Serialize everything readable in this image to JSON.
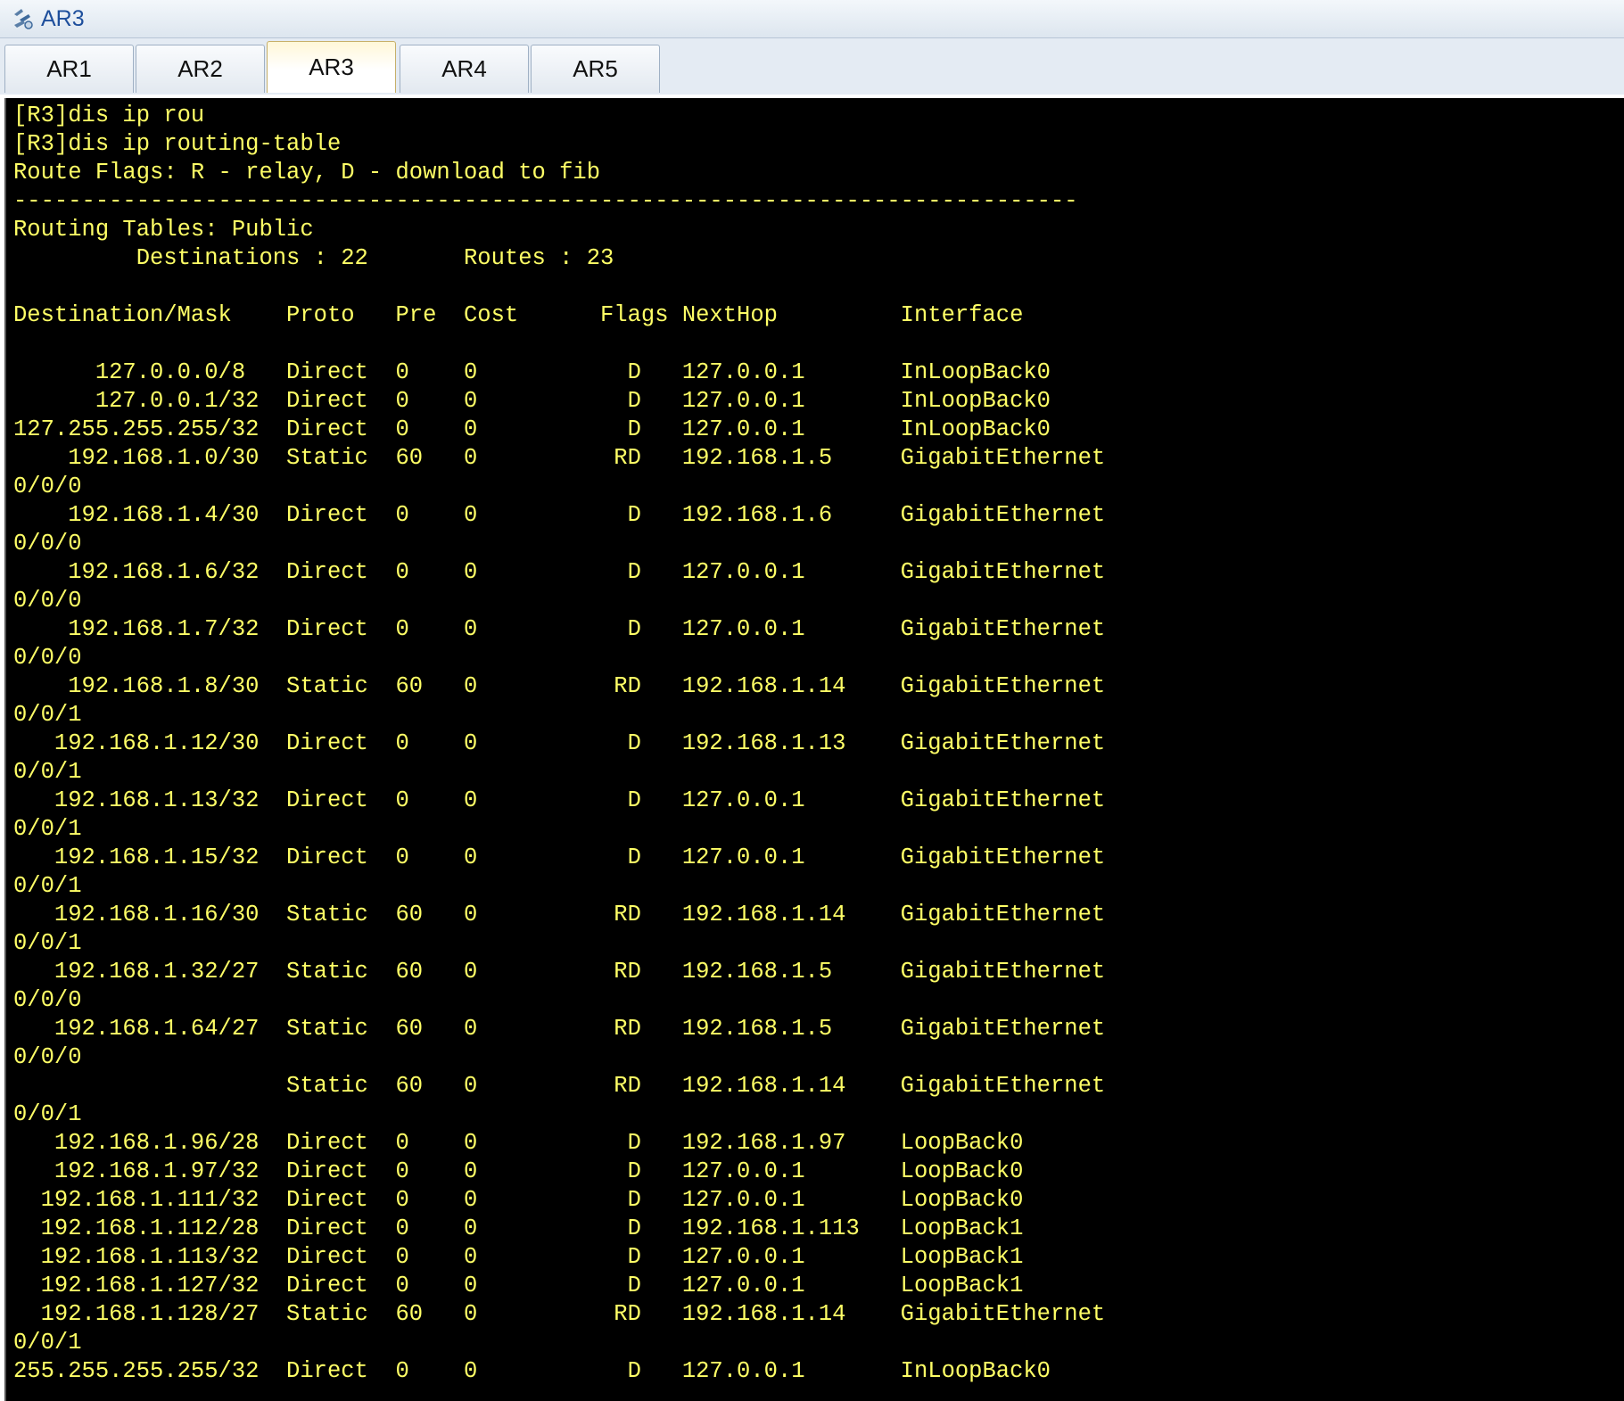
{
  "window": {
    "title": "AR3",
    "icon": "router-icon"
  },
  "tabs": [
    {
      "label": "AR1",
      "active": false
    },
    {
      "label": "AR2",
      "active": false
    },
    {
      "label": "AR3",
      "active": true
    },
    {
      "label": "AR4",
      "active": false
    },
    {
      "label": "AR5",
      "active": false
    }
  ],
  "colors": {
    "terminal_background": "#000000",
    "terminal_text": "#ffff66",
    "title_text": "#1e4f9c"
  },
  "terminal": {
    "lines": [
      "[R3]dis ip rou",
      "[R3]dis ip routing-table",
      "Route Flags: R - relay, D - download to fib",
      "------------------------------------------------------------------------------",
      "Routing Tables: Public",
      "         Destinations : 22       Routes : 23",
      "",
      "Destination/Mask    Proto   Pre  Cost      Flags NextHop         Interface",
      "",
      "      127.0.0.0/8   Direct  0    0           D   127.0.0.1       InLoopBack0",
      "      127.0.0.1/32  Direct  0    0           D   127.0.0.1       InLoopBack0",
      "127.255.255.255/32  Direct  0    0           D   127.0.0.1       InLoopBack0",
      "    192.168.1.0/30  Static  60   0          RD   192.168.1.5     GigabitEthernet",
      "0/0/0",
      "    192.168.1.4/30  Direct  0    0           D   192.168.1.6     GigabitEthernet",
      "0/0/0",
      "    192.168.1.6/32  Direct  0    0           D   127.0.0.1       GigabitEthernet",
      "0/0/0",
      "    192.168.1.7/32  Direct  0    0           D   127.0.0.1       GigabitEthernet",
      "0/0/0",
      "    192.168.1.8/30  Static  60   0          RD   192.168.1.14    GigabitEthernet",
      "0/0/1",
      "   192.168.1.12/30  Direct  0    0           D   192.168.1.13    GigabitEthernet",
      "0/0/1",
      "   192.168.1.13/32  Direct  0    0           D   127.0.0.1       GigabitEthernet",
      "0/0/1",
      "   192.168.1.15/32  Direct  0    0           D   127.0.0.1       GigabitEthernet",
      "0/0/1",
      "   192.168.1.16/30  Static  60   0          RD   192.168.1.14    GigabitEthernet",
      "0/0/1",
      "   192.168.1.32/27  Static  60   0          RD   192.168.1.5     GigabitEthernet",
      "0/0/0",
      "   192.168.1.64/27  Static  60   0          RD   192.168.1.5     GigabitEthernet",
      "0/0/0",
      "                    Static  60   0          RD   192.168.1.14    GigabitEthernet",
      "0/0/1",
      "   192.168.1.96/28  Direct  0    0           D   192.168.1.97    LoopBack0",
      "   192.168.1.97/32  Direct  0    0           D   127.0.0.1       LoopBack0",
      "  192.168.1.111/32  Direct  0    0           D   127.0.0.1       LoopBack0",
      "  192.168.1.112/28  Direct  0    0           D   192.168.1.113   LoopBack1",
      "  192.168.1.113/32  Direct  0    0           D   127.0.0.1       LoopBack1",
      "  192.168.1.127/32  Direct  0    0           D   127.0.0.1       LoopBack1",
      "  192.168.1.128/27  Static  60   0          RD   192.168.1.14    GigabitEthernet",
      "0/0/1",
      "255.255.255.255/32  Direct  0    0           D   127.0.0.1       InLoopBack0"
    ]
  }
}
